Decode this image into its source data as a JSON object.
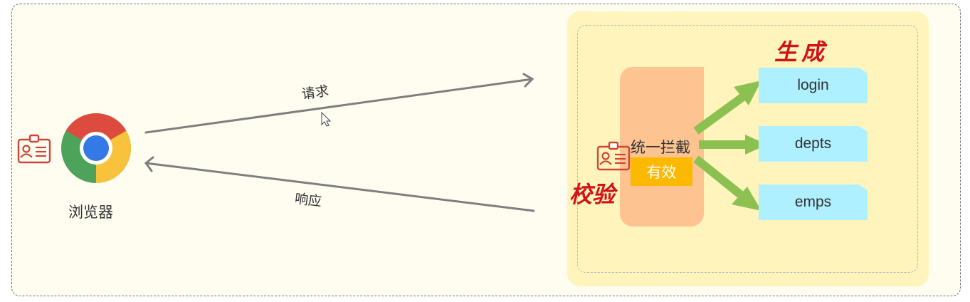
{
  "browser": {
    "label": "浏览器"
  },
  "arrows": {
    "request_label": "请求",
    "response_label": "响应"
  },
  "server": {
    "interceptor_label": "统一拦截",
    "valid_badge": "有效",
    "verify_label": "校验",
    "generate_label": "生成",
    "endpoints": [
      "login",
      "depts",
      "emps"
    ]
  },
  "colors": {
    "frame_bg": "#fffdf0",
    "server_bg": "#fff4bb",
    "interceptor_bg": "#fdc391",
    "endpoint_bg": "#aef0ff",
    "badge_bg": "#fdb800",
    "green_arrow": "#8cc152",
    "red_text": "#d0141b",
    "flow_arrow": "#7f7f7f"
  },
  "icons": [
    "id-card-icon",
    "chrome-icon",
    "cursor-icon"
  ]
}
